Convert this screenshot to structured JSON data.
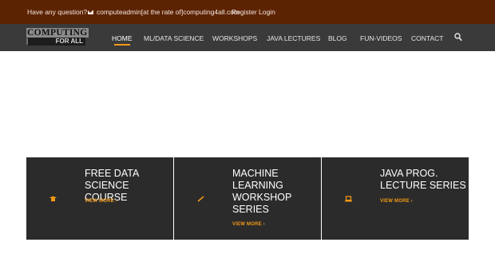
{
  "topbar": {
    "question": "Have any question?",
    "email": "computeadmin[at the rate of]computing4all.com",
    "register": "Register",
    "login": "Login"
  },
  "logo": {
    "line1": "COMPUTING",
    "line2": "FOR ALL"
  },
  "nav": {
    "items": [
      "HOME",
      "ML/DATA SCIENCE",
      "WORKSHOPS",
      "JAVA LECTURES",
      "BLOG",
      "FUN-VIDEOS",
      "CONTACT"
    ],
    "active": "HOME",
    "search_icon": "search-icon"
  },
  "cards": [
    {
      "title": "FREE DATA SCIENCE COURSE",
      "more": "VIEW MORE ›",
      "icon": "graduation-cap-icon"
    },
    {
      "title": "MACHINE LEARNING WORKSHOP SERIES",
      "more": "VIEW MORE ›",
      "icon": "pencil-icon"
    },
    {
      "title": "JAVA PROG. LECTURE SERIES",
      "more": "VIEW MORE ›",
      "icon": "laptop-icon"
    }
  ],
  "colors": {
    "topbar_bg": "#5c2303",
    "nav_bg": "#3a3a3a",
    "accent": "#f39a16",
    "card_bg": "#2b2b2b"
  }
}
